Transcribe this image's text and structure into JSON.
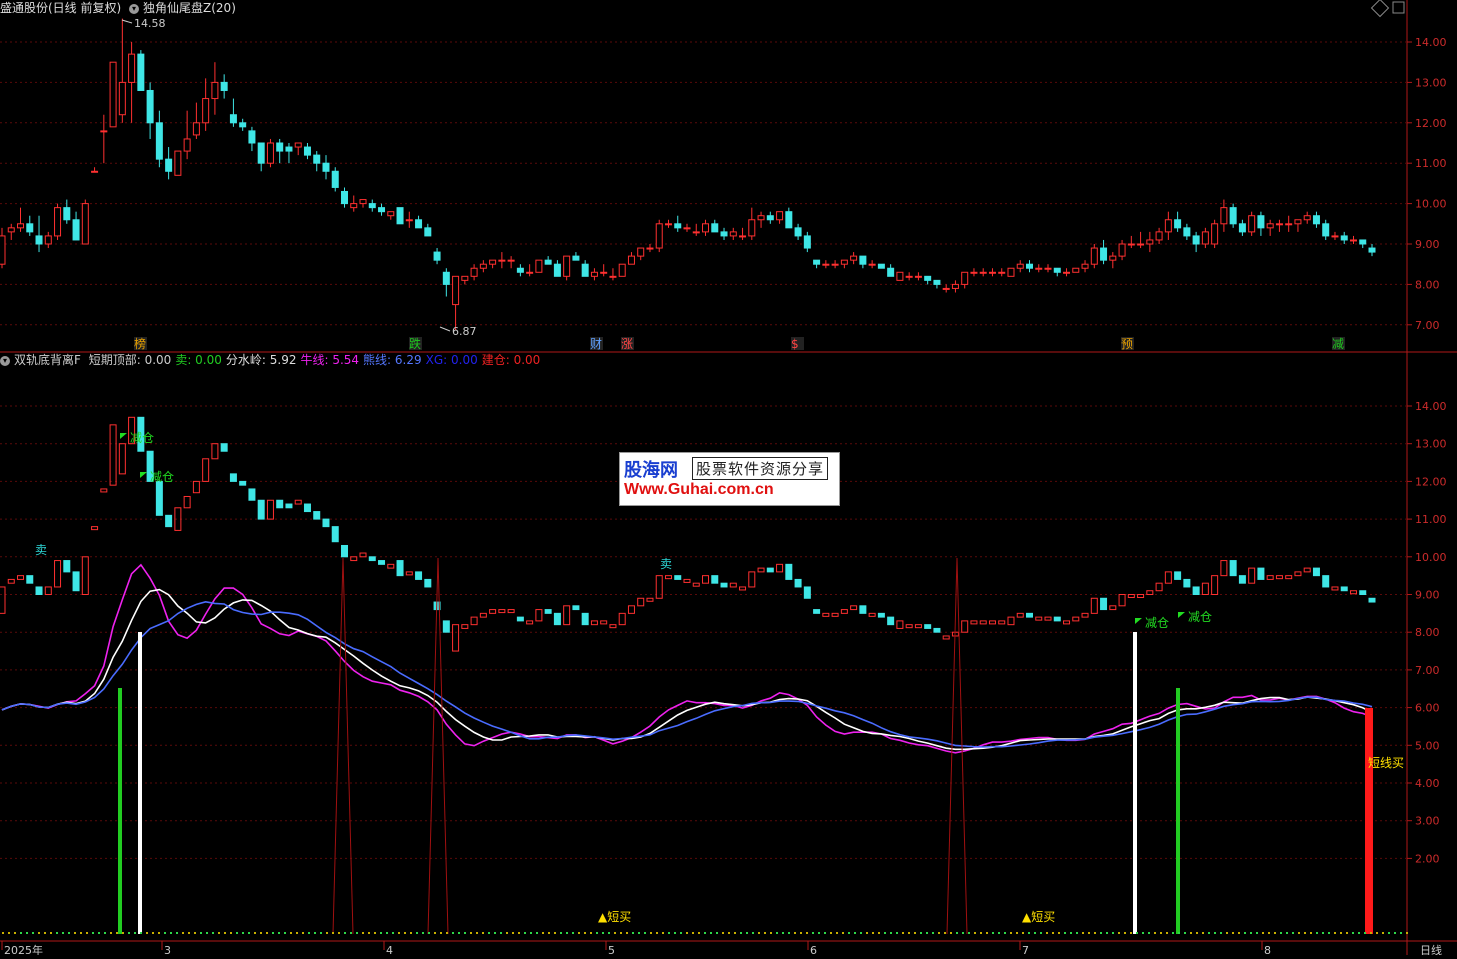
{
  "main_header": {
    "title": "盛通股份(日线 前复权)",
    "indicator": "独角仙尾盘Z(20)"
  },
  "sub_header": {
    "name": "双轨底背离F",
    "fields": [
      {
        "label": "短期顶部:",
        "value": "0.00",
        "color": "#cccccc"
      },
      {
        "label": "卖:",
        "value": "0.00",
        "color": "#22cc22"
      },
      {
        "label": "分水岭:",
        "value": "5.92",
        "color": "#dddddd"
      },
      {
        "label": "牛线:",
        "value": "5.54",
        "color": "#ee22ee"
      },
      {
        "label": "熊线:",
        "value": "6.29",
        "color": "#5577ff"
      },
      {
        "label": "XG:",
        "value": "0.00",
        "color": "#2222ee"
      },
      {
        "label": "建仓:",
        "value": "0.00",
        "color": "#ee2222"
      }
    ]
  },
  "main_axis_ticks": [
    "14.00",
    "13.00",
    "12.00",
    "11.00",
    "10.00",
    "9.00",
    "8.00",
    "7.00"
  ],
  "sub_axis_ticks": [
    "14.00",
    "13.00",
    "12.00",
    "11.00",
    "10.00",
    "9.00",
    "8.00",
    "7.00",
    "6.00",
    "5.00",
    "4.00",
    "3.00",
    "2.00"
  ],
  "price_annotations": {
    "high": "14.58",
    "low": "6.87"
  },
  "event_markers": [
    "榜",
    "跌",
    "财",
    "涨",
    "$",
    "预",
    "减"
  ],
  "signals": {
    "reduce": "减仓",
    "sell": "卖",
    "short_buy": "短买",
    "short_buy2": "短线买"
  },
  "time_labels": [
    "2025年",
    "3",
    "4",
    "5",
    "6",
    "7",
    "8"
  ],
  "period_label": "日线",
  "watermark": {
    "brand": "股海网",
    "slogan": "股票软件资源分享",
    "url": "Www.Guhai.com.cn"
  },
  "chart_data": {
    "type": "candlestick",
    "series": [
      {
        "name": "盛通股份",
        "values": [
          [
            8.5,
            9.4,
            8.4,
            9.2
          ],
          [
            9.3,
            9.5,
            9.1,
            9.4
          ],
          [
            9.4,
            9.9,
            9.3,
            9.5
          ],
          [
            9.5,
            9.7,
            9.2,
            9.3
          ],
          [
            9.2,
            9.7,
            8.8,
            9.0
          ],
          [
            9.0,
            9.3,
            8.9,
            9.2
          ],
          [
            9.2,
            10.0,
            9.1,
            9.9
          ],
          [
            9.9,
            10.1,
            9.5,
            9.6
          ],
          [
            9.6,
            9.8,
            9.3,
            9.1
          ],
          [
            9.0,
            10.1,
            9.0,
            10.0
          ],
          [
            10.8,
            10.9,
            10.8,
            10.8
          ],
          [
            11.8,
            12.2,
            11.0,
            11.8
          ],
          [
            11.9,
            13.5,
            11.9,
            13.5
          ],
          [
            12.2,
            14.58,
            12.0,
            13.0
          ],
          [
            13.0,
            14.0,
            12.0,
            13.7
          ],
          [
            13.7,
            13.8,
            12.8,
            12.8
          ],
          [
            12.8,
            13.0,
            11.6,
            12.0
          ],
          [
            12.0,
            12.3,
            10.9,
            11.1
          ],
          [
            11.1,
            11.4,
            10.6,
            10.8
          ],
          [
            10.7,
            11.3,
            10.7,
            11.3
          ],
          [
            11.3,
            12.3,
            11.1,
            11.6
          ],
          [
            11.7,
            12.5,
            11.6,
            12.0
          ],
          [
            12.0,
            13.1,
            11.8,
            12.6
          ],
          [
            12.6,
            13.5,
            12.2,
            13.0
          ],
          [
            13.0,
            13.2,
            12.6,
            12.8
          ],
          [
            12.2,
            12.6,
            11.9,
            12.0
          ],
          [
            12.0,
            12.1,
            11.8,
            11.9
          ],
          [
            11.8,
            11.9,
            11.3,
            11.5
          ],
          [
            11.5,
            11.5,
            10.8,
            11.0
          ],
          [
            11.0,
            11.6,
            10.9,
            11.5
          ],
          [
            11.5,
            11.6,
            11.0,
            11.3
          ],
          [
            11.4,
            11.5,
            11.0,
            11.3
          ],
          [
            11.4,
            11.5,
            11.2,
            11.5
          ],
          [
            11.4,
            11.5,
            11.1,
            11.2
          ],
          [
            11.2,
            11.3,
            10.8,
            11.0
          ],
          [
            11.0,
            11.2,
            10.6,
            10.8
          ],
          [
            10.8,
            10.9,
            10.3,
            10.4
          ],
          [
            10.3,
            10.4,
            9.9,
            10.0
          ],
          [
            9.9,
            10.2,
            9.8,
            10.0
          ],
          [
            10.0,
            10.1,
            9.9,
            10.1
          ],
          [
            10.0,
            10.1,
            9.8,
            9.9
          ],
          [
            9.9,
            10.0,
            9.7,
            9.8
          ],
          [
            9.7,
            9.8,
            9.6,
            9.8
          ],
          [
            9.9,
            9.9,
            9.5,
            9.5
          ],
          [
            9.6,
            9.8,
            9.4,
            9.6
          ],
          [
            9.6,
            9.7,
            9.4,
            9.4
          ],
          [
            9.4,
            9.5,
            9.2,
            9.2
          ],
          [
            8.8,
            8.9,
            8.5,
            8.6
          ],
          [
            8.3,
            8.4,
            7.7,
            8.0
          ],
          [
            7.5,
            8.2,
            6.87,
            8.2
          ],
          [
            8.1,
            8.2,
            8.0,
            8.2
          ],
          [
            8.2,
            8.5,
            8.1,
            8.4
          ],
          [
            8.4,
            8.6,
            8.3,
            8.5
          ],
          [
            8.5,
            8.6,
            8.4,
            8.6
          ],
          [
            8.6,
            8.8,
            8.4,
            8.6
          ],
          [
            8.6,
            8.7,
            8.4,
            8.6
          ],
          [
            8.4,
            8.5,
            8.2,
            8.3
          ],
          [
            8.3,
            8.5,
            8.2,
            8.3
          ],
          [
            8.3,
            8.6,
            8.3,
            8.6
          ],
          [
            8.6,
            8.7,
            8.5,
            8.5
          ],
          [
            8.5,
            8.6,
            8.2,
            8.2
          ],
          [
            8.2,
            8.7,
            8.1,
            8.7
          ],
          [
            8.7,
            8.8,
            8.6,
            8.6
          ],
          [
            8.5,
            8.6,
            8.2,
            8.2
          ],
          [
            8.2,
            8.4,
            8.1,
            8.3
          ],
          [
            8.3,
            8.5,
            8.2,
            8.3
          ],
          [
            8.2,
            8.4,
            8.1,
            8.2
          ],
          [
            8.2,
            8.5,
            8.2,
            8.5
          ],
          [
            8.5,
            8.8,
            8.5,
            8.7
          ],
          [
            8.7,
            8.9,
            8.6,
            8.9
          ],
          [
            8.9,
            9.0,
            8.8,
            8.9
          ],
          [
            8.9,
            9.6,
            8.8,
            9.5
          ],
          [
            9.5,
            9.6,
            9.4,
            9.5
          ],
          [
            9.5,
            9.7,
            9.3,
            9.4
          ],
          [
            9.4,
            9.5,
            9.3,
            9.4
          ],
          [
            9.3,
            9.5,
            9.2,
            9.3
          ],
          [
            9.3,
            9.6,
            9.2,
            9.5
          ],
          [
            9.5,
            9.6,
            9.3,
            9.3
          ],
          [
            9.3,
            9.4,
            9.1,
            9.2
          ],
          [
            9.2,
            9.4,
            9.1,
            9.3
          ],
          [
            9.2,
            9.4,
            9.1,
            9.2
          ],
          [
            9.2,
            9.9,
            9.1,
            9.6
          ],
          [
            9.6,
            9.8,
            9.4,
            9.7
          ],
          [
            9.7,
            9.8,
            9.5,
            9.6
          ],
          [
            9.6,
            9.8,
            9.5,
            9.8
          ],
          [
            9.8,
            9.9,
            9.4,
            9.4
          ],
          [
            9.4,
            9.5,
            9.1,
            9.2
          ],
          [
            9.2,
            9.3,
            8.8,
            8.9
          ],
          [
            8.6,
            8.6,
            8.4,
            8.5
          ],
          [
            8.5,
            8.6,
            8.4,
            8.5
          ],
          [
            8.5,
            8.6,
            8.4,
            8.5
          ],
          [
            8.5,
            8.6,
            8.4,
            8.6
          ],
          [
            8.6,
            8.8,
            8.5,
            8.7
          ],
          [
            8.7,
            8.7,
            8.4,
            8.5
          ],
          [
            8.5,
            8.6,
            8.4,
            8.5
          ],
          [
            8.5,
            8.5,
            8.4,
            8.4
          ],
          [
            8.4,
            8.5,
            8.2,
            8.2
          ],
          [
            8.1,
            8.3,
            8.1,
            8.3
          ],
          [
            8.2,
            8.3,
            8.1,
            8.2
          ],
          [
            8.2,
            8.3,
            8.1,
            8.2
          ],
          [
            8.2,
            8.2,
            8.0,
            8.1
          ],
          [
            8.1,
            8.1,
            7.9,
            8.0
          ],
          [
            7.9,
            8.0,
            7.8,
            7.9
          ],
          [
            7.9,
            8.1,
            7.8,
            8.0
          ],
          [
            8.0,
            8.3,
            7.9,
            8.3
          ],
          [
            8.3,
            8.4,
            8.2,
            8.3
          ],
          [
            8.3,
            8.4,
            8.2,
            8.3
          ],
          [
            8.3,
            8.4,
            8.2,
            8.3
          ],
          [
            8.3,
            8.4,
            8.2,
            8.3
          ],
          [
            8.2,
            8.4,
            8.2,
            8.4
          ],
          [
            8.4,
            8.6,
            8.3,
            8.5
          ],
          [
            8.5,
            8.6,
            8.3,
            8.4
          ],
          [
            8.4,
            8.5,
            8.3,
            8.4
          ],
          [
            8.4,
            8.5,
            8.3,
            8.4
          ],
          [
            8.4,
            8.4,
            8.2,
            8.3
          ],
          [
            8.3,
            8.4,
            8.2,
            8.3
          ],
          [
            8.3,
            8.4,
            8.3,
            8.4
          ],
          [
            8.4,
            8.6,
            8.3,
            8.5
          ],
          [
            8.5,
            9.0,
            8.4,
            8.9
          ],
          [
            8.9,
            9.1,
            8.5,
            8.6
          ],
          [
            8.6,
            8.8,
            8.4,
            8.7
          ],
          [
            8.7,
            9.1,
            8.6,
            9.0
          ],
          [
            9.0,
            9.2,
            8.9,
            9.0
          ],
          [
            9.0,
            9.3,
            8.9,
            9.0
          ],
          [
            9.0,
            9.3,
            8.8,
            9.1
          ],
          [
            9.1,
            9.4,
            9.0,
            9.3
          ],
          [
            9.3,
            9.8,
            9.1,
            9.6
          ],
          [
            9.6,
            9.8,
            9.3,
            9.4
          ],
          [
            9.4,
            9.5,
            9.1,
            9.2
          ],
          [
            9.2,
            9.3,
            8.8,
            9.0
          ],
          [
            9.0,
            9.4,
            8.9,
            9.3
          ],
          [
            9.0,
            9.6,
            8.9,
            9.5
          ],
          [
            9.5,
            10.1,
            9.3,
            9.9
          ],
          [
            9.9,
            10.0,
            9.4,
            9.5
          ],
          [
            9.5,
            9.6,
            9.2,
            9.3
          ],
          [
            9.3,
            9.8,
            9.2,
            9.7
          ],
          [
            9.7,
            9.8,
            9.2,
            9.4
          ],
          [
            9.4,
            9.6,
            9.2,
            9.5
          ],
          [
            9.5,
            9.6,
            9.3,
            9.5
          ],
          [
            9.5,
            9.7,
            9.3,
            9.5
          ],
          [
            9.5,
            9.6,
            9.3,
            9.6
          ],
          [
            9.6,
            9.8,
            9.5,
            9.7
          ],
          [
            9.7,
            9.8,
            9.4,
            9.5
          ],
          [
            9.5,
            9.6,
            9.1,
            9.2
          ],
          [
            9.2,
            9.3,
            9.1,
            9.2
          ],
          [
            9.2,
            9.3,
            9.0,
            9.1
          ],
          [
            9.1,
            9.2,
            9.0,
            9.1
          ],
          [
            9.1,
            9.1,
            8.9,
            9.0
          ],
          [
            8.9,
            9.0,
            8.7,
            8.8
          ]
        ]
      }
    ],
    "ylim": [
      6.5,
      15.0
    ],
    "grid": true
  }
}
